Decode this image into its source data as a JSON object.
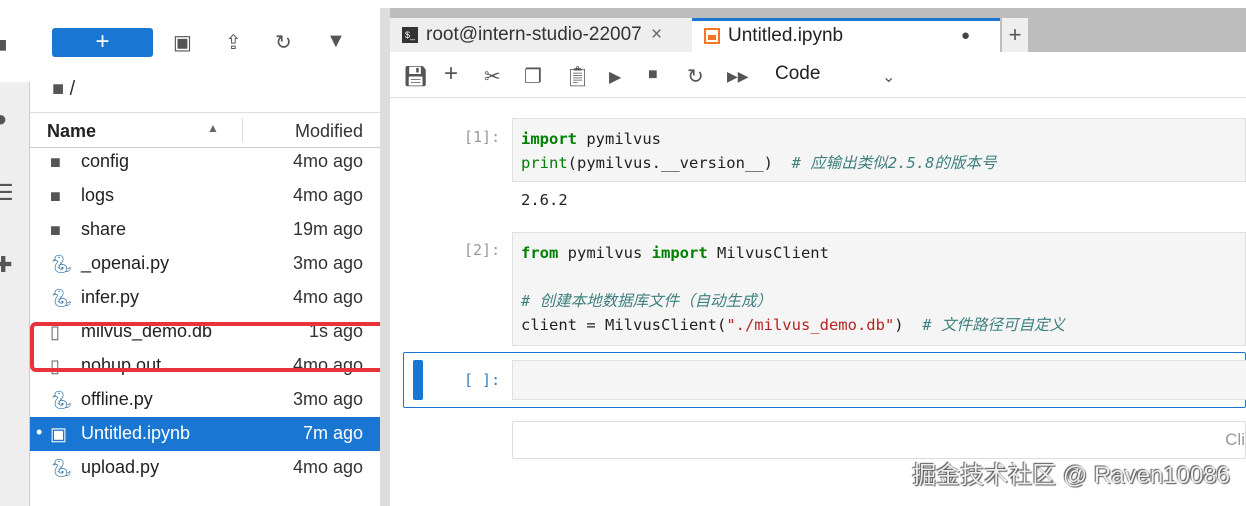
{
  "browser": {
    "new_label": "+",
    "breadcrumb": "/",
    "columns": {
      "name": "Name",
      "modified": "Modified"
    },
    "files": [
      {
        "name": "config",
        "modified": "4mo ago",
        "type": "folder"
      },
      {
        "name": "logs",
        "modified": "4mo ago",
        "type": "folder"
      },
      {
        "name": "share",
        "modified": "19m ago",
        "type": "folder"
      },
      {
        "name": "_openai.py",
        "modified": "3mo ago",
        "type": "python"
      },
      {
        "name": "infer.py",
        "modified": "4mo ago",
        "type": "python"
      },
      {
        "name": "milvus_demo.db",
        "modified": "1s ago",
        "type": "file",
        "highlighted": true
      },
      {
        "name": "nohup.out",
        "modified": "4mo ago",
        "type": "file"
      },
      {
        "name": "offline.py",
        "modified": "3mo ago",
        "type": "python"
      },
      {
        "name": "Untitled.ipynb",
        "modified": "7m ago",
        "type": "notebook",
        "selected": true,
        "running_dot": "•"
      },
      {
        "name": "upload.py",
        "modified": "4mo ago",
        "type": "python"
      }
    ]
  },
  "tabs": [
    {
      "label": "root@intern-studio-22007",
      "icon": "terminal-icon",
      "close": "×"
    },
    {
      "label": "Untitled.ipynb",
      "icon": "notebook-icon",
      "status": "●",
      "active": true
    }
  ],
  "tab_add": "+",
  "toolbar": {
    "cell_type": "Code"
  },
  "cells": [
    {
      "prompt": "[1]:",
      "code": [
        "import pymilvus",
        "print(pymilvus.__version__)  # 应输出类似2.5.8的版本号"
      ],
      "output": "2.6.2"
    },
    {
      "prompt": "[2]:",
      "code": [
        "from pymilvus import MilvusClient",
        "",
        "# 创建本地数据库文件（自动生成）",
        "client = MilvusClient(\"./milvus_demo.db\")  # 文件路径可自定义"
      ]
    },
    {
      "prompt": "[ ]:",
      "code": []
    }
  ],
  "extra_hint": "Cli",
  "watermark": "掘金技术社区 @ Raven10086",
  "colors": {
    "accent": "#1976d2",
    "highlight": "#e8323c"
  }
}
